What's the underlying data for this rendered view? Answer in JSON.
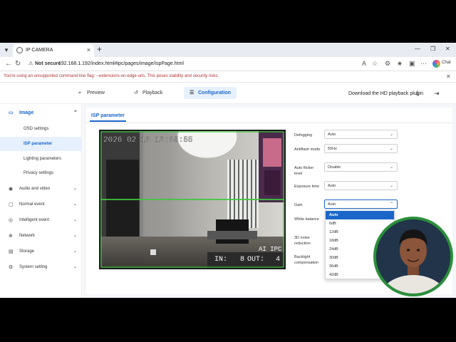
{
  "browser": {
    "tab_title": "IP CAMERA",
    "security_label": "Not secure",
    "url": "192.168.1.192/index.html#ipc/pages/image/ispPage.html",
    "chat_label": "Chat",
    "info_message": "You're using an unsupported command-line flag: --extensions-on-edge-urls. This poses stability and security risks."
  },
  "nav": {
    "preview": "Preview",
    "playback": "Playback",
    "configuration": "Configuration",
    "download": "Download the HD playback plugin"
  },
  "sidebar": {
    "image_header": "Image",
    "subitems": [
      "OSD settings",
      "ISP parameter",
      "Lighting parameters",
      "Privacy settings"
    ],
    "items": [
      "Audio and video",
      "Normal event",
      "Intelligent event",
      "Network",
      "Storage",
      "System setting"
    ]
  },
  "panel": {
    "tab_label": "ISP parameter"
  },
  "video": {
    "timestamp": "2026 02 13 13:35:55",
    "watermark": "AI IPC",
    "in_label": "IN:",
    "in_count": "8",
    "out_label": "OUT:",
    "out_count": "4"
  },
  "params": [
    {
      "label": "Defogging",
      "value": "Auto"
    },
    {
      "label": "Antiflash mode",
      "value": "50Hz"
    },
    {
      "label": "Auto flicker level",
      "value": "Disable"
    },
    {
      "label": "Exposure time",
      "value": "Auto"
    },
    {
      "label": "Gain",
      "value": "Auto"
    },
    {
      "label": "White balance",
      "value": ""
    },
    {
      "label": "3D noise reduction",
      "value": ""
    },
    {
      "label": "Backlight compensation",
      "value": ""
    }
  ],
  "gain_options": [
    "Auto",
    "6dB",
    "12dB",
    "18dB",
    "24dB",
    "30dB",
    "36dB",
    "42dB"
  ],
  "colors": {
    "accent": "#1a67c9",
    "line_green": "#3cc83c"
  }
}
